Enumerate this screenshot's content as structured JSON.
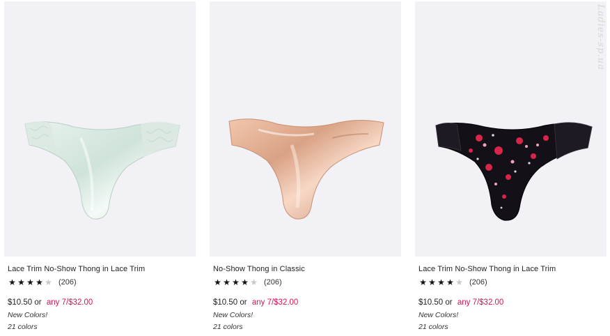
{
  "products": [
    {
      "name": "Lace Trim No-Show Thong in Lace Trim",
      "image": "mint-satin-lace-thong",
      "rating_value": 4,
      "rating_max": 5,
      "review_count": "(206)",
      "price": "$10.50",
      "price_connector": "or",
      "deal": "any 7/$32.00",
      "badge": "New Colors!",
      "colors": "21 colors"
    },
    {
      "name": "No-Show Thong in Classic",
      "image": "rose-gold-shimmer-thong",
      "rating_value": 4,
      "rating_max": 5,
      "review_count": "(206)",
      "price": "$10.50",
      "price_connector": "or",
      "deal": "any 7/$32.00",
      "badge": "New Colors!",
      "colors": "21 colors"
    },
    {
      "name": "Lace Trim No-Show Thong in Lace Trim",
      "image": "black-floral-lace-thong",
      "rating_value": 4,
      "rating_max": 5,
      "review_count": "(206)",
      "price": "$10.50",
      "price_connector": "or",
      "deal": "any 7/$32.00",
      "badge": "New Colors!",
      "colors": "21 colors"
    }
  ],
  "watermark": "Ladies-sp.ua",
  "colors": {
    "deal": "#d4145a",
    "image_bg": "#f2f2f6",
    "star_on": "#111111",
    "star_off": "#c8c8c8"
  }
}
